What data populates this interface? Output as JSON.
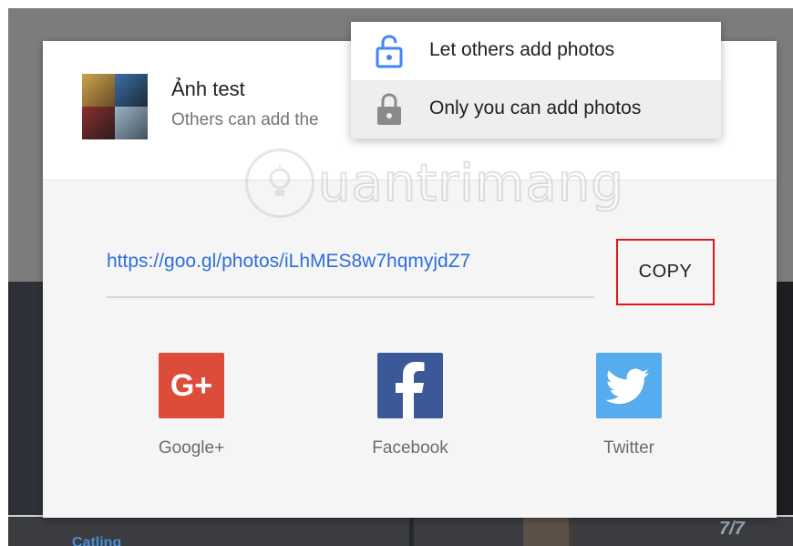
{
  "dialog": {
    "album_title": "Ảnh test",
    "album_subtitle": "Others can add the",
    "share_url": "https://goo.gl/photos/iLhMES8w7hqmyjdZ7",
    "copy_label": "COPY"
  },
  "menu": {
    "items": [
      {
        "label": "Let others add photos",
        "icon": "unlock-icon",
        "icon_color": "#4285f4"
      },
      {
        "label": "Only you can add photos",
        "icon": "lock-icon",
        "icon_color": "#8a8a8a"
      }
    ]
  },
  "share_targets": [
    {
      "label": "Google+",
      "icon": "google-plus-icon",
      "color": "#dd4b39"
    },
    {
      "label": "Facebook",
      "icon": "facebook-icon",
      "color": "#3b5998"
    },
    {
      "label": "Twitter",
      "icon": "twitter-icon",
      "color": "#55acee"
    }
  ],
  "watermark": {
    "text": "uantrimang"
  },
  "background": {
    "counter": "7/7",
    "label": "Catling"
  },
  "colors": {
    "link": "#2f6fd8",
    "highlight_box": "#e0161b"
  }
}
